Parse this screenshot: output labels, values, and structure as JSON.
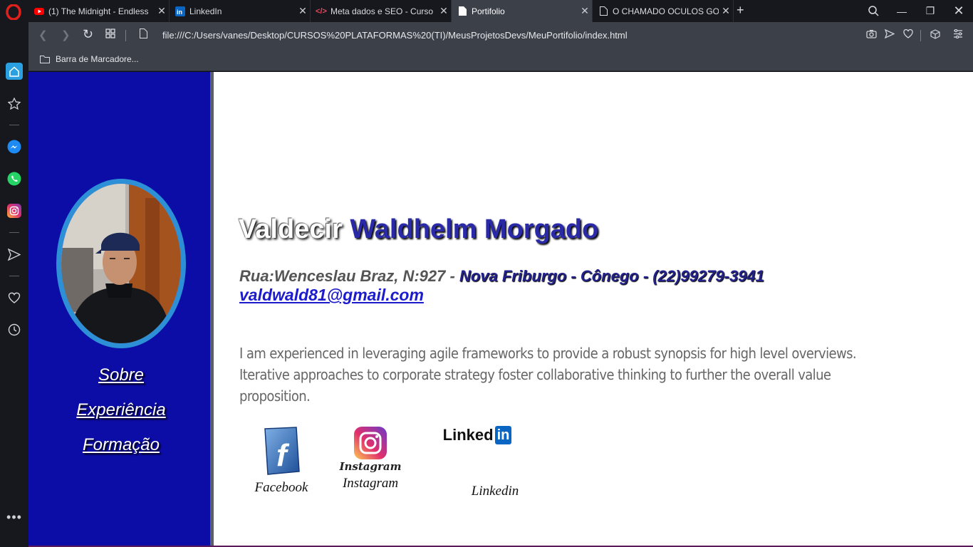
{
  "browser": {
    "tabs": [
      {
        "title": "(1) The Midnight - Endless",
        "favicon": "youtube-icon",
        "active": false
      },
      {
        "title": "LinkedIn",
        "favicon": "linkedin-icon",
        "active": false
      },
      {
        "title": "Meta dados e SEO - Curso",
        "favicon": "code-icon",
        "active": false
      },
      {
        "title": "Portifolio",
        "favicon": "file-icon",
        "active": true
      },
      {
        "title": "O CHAMADO OCULOS GO",
        "favicon": "file-icon",
        "active": false
      }
    ],
    "address_bar": {
      "url": "file:///C:/Users/vanes/Desktop/CURSOS%20PLATAFORMAS%20(TI)/MeusProjetosDevs/MeuPortifolio/index.html"
    },
    "bookmarks_bar": {
      "label": "Barra de Marcadore..."
    },
    "accent": "#d41a1a"
  },
  "profile": {
    "first_name": "Valdecir",
    "last_name": "Waldhelm Morgado",
    "address_part1": "Rua:Wenceslau Braz, N:927 -",
    "address_part2": "Nova Friburgo - Cônego - (22)99279-3941",
    "email": "valdwald81@gmail.com",
    "bio": "I am experienced in leveraging agile frameworks to provide a robust synopsis for high level overviews. Iterative approaches to corporate strategy foster collaborative thinking to further the overall value proposition."
  },
  "menu": {
    "items": [
      {
        "label": "Sobre"
      },
      {
        "label": "Experiência"
      },
      {
        "label": "Formação"
      }
    ]
  },
  "social": {
    "facebook": {
      "label": "Facebook"
    },
    "instagram": {
      "label": "Instagram",
      "logo_text": "Instagram"
    },
    "linkedin": {
      "label": "Linkedin",
      "logo_text": "Linked",
      "logo_in": "in"
    }
  },
  "colors": {
    "sidebar_bg": "#0c0ca6",
    "photo_border": "#2d8fd6",
    "name_last": "#2a2aa8"
  }
}
